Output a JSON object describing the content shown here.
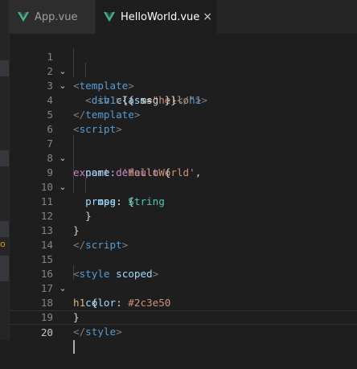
{
  "tabs": [
    {
      "label": "App.vue",
      "active": false,
      "icon": "vue-icon"
    },
    {
      "label": "HelloWorld.vue",
      "active": true,
      "icon": "vue-icon",
      "close": "×"
    }
  ],
  "sidebar_marker": "o",
  "line_numbers": [
    "1",
    "2",
    "3",
    "4",
    "5",
    "6",
    "7",
    "8",
    "9",
    "10",
    "11",
    "12",
    "13",
    "14",
    "15",
    "16",
    "17",
    "18",
    "19",
    "20"
  ],
  "code": {
    "l1": {
      "lt": "<",
      "tag": "template",
      "gt": ">"
    },
    "l2": {
      "lt": "<",
      "tag": "div",
      "attr": "class",
      "eq": "=",
      "val": "\"hello\"",
      "gt": ">"
    },
    "l3": {
      "lt1": "<",
      "tag1": "h1",
      "gt1": ">",
      "text": "{{ msg }}",
      "lt2": "</",
      "tag2": "h1",
      "gt2": ">"
    },
    "l4": {
      "lt": "</",
      "tag": "template",
      "gt": ">"
    },
    "l6": {
      "lt": "<",
      "tag": "script",
      "gt": ">"
    },
    "l7": {
      "kw1": "export",
      "kw2": "default",
      "brace": "{"
    },
    "l8": {
      "key": "name",
      "colon": ":",
      "str": "'HelloWorld'",
      "comma": ","
    },
    "l9": {
      "key": "props",
      "colon": ":",
      "brace": "{"
    },
    "l10": {
      "key": "msg",
      "colon": ":",
      "type": "String"
    },
    "l11": {
      "brace": "}"
    },
    "l12": {
      "brace": "}"
    },
    "l13": {
      "lt": "</",
      "tag": "script",
      "gt": ">"
    },
    "l15": {
      "lt": "<",
      "tag": "style",
      "attr": "scoped",
      "gt": ">"
    },
    "l16": {
      "sel": "h1",
      "brace": "{"
    },
    "l17": {
      "prop": "color",
      "colon": ":",
      "val": "#2c3e50"
    },
    "l18": {
      "brace": "}"
    },
    "l19": {
      "lt": "</",
      "tag": "style",
      "gt": ">"
    }
  },
  "colors": {
    "background": "#1e1e1e",
    "tag": "#569cd6",
    "attribute": "#9cdcfe",
    "string": "#ce9178",
    "keyword": "#c586c0",
    "type": "#4ec9b0",
    "selector": "#d7ba7d"
  }
}
